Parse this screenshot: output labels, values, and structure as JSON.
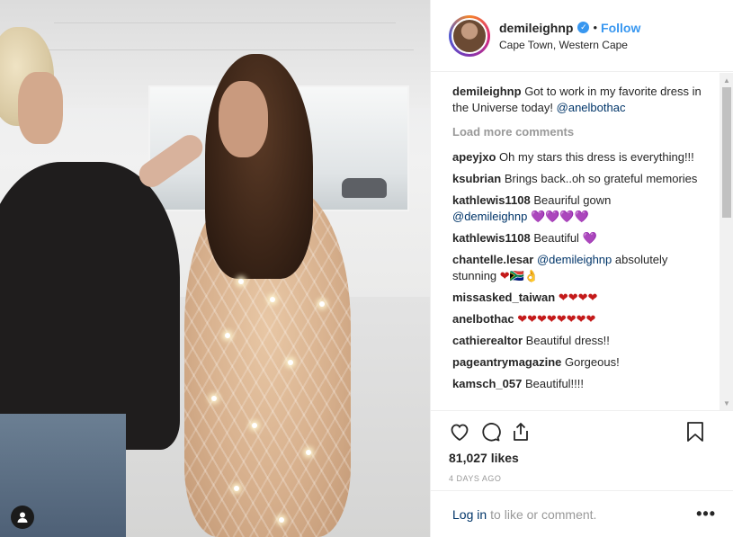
{
  "header": {
    "username": "demileighnp",
    "verified_icon": "verified-badge-icon",
    "separator": "•",
    "follow_label": "Follow",
    "location": "Cape Town, Western Cape"
  },
  "caption": {
    "username": "demileighnp",
    "text": "Got to work in my favorite dress in the Universe today!",
    "mention": "@anelbothac"
  },
  "load_more_label": "Load more comments",
  "comments": [
    {
      "username": "apeyjxo",
      "text": "Oh my stars this dress is everything!!!"
    },
    {
      "username": "ksubrian",
      "text": "Brings back..oh so grateful memories"
    },
    {
      "username": "kathlewis1108",
      "text": "Beauriful gown",
      "mention": "@demileighnp",
      "emoji": "💜💜💜💜"
    },
    {
      "username": "kathlewis1108",
      "text": "Beautiful",
      "emoji": "💜"
    },
    {
      "username": "chantelle.lesar",
      "mention": "@demileighnp",
      "text": "absolutely stunning",
      "emoji": "❤🇿🇦👌"
    },
    {
      "username": "missasked_taiwan",
      "text": "",
      "emoji": "❤❤❤❤"
    },
    {
      "username": "anelbothac",
      "text": "",
      "emoji": "❤❤❤❤❤❤❤❤"
    },
    {
      "username": "cathierealtor",
      "text": "Beautiful dress!!"
    },
    {
      "username": "pageantrymagazine",
      "text": "Gorgeous!"
    },
    {
      "username": "kamsch_057",
      "text": "Beautiful!!!!"
    }
  ],
  "likes": "81,027 likes",
  "time_ago": "4 DAYS AGO",
  "login": {
    "link": "Log in",
    "rest": "to like or comment.",
    "more": "•••"
  },
  "colors": {
    "link_blue": "#3897f0",
    "mention": "#003569",
    "muted": "#999999"
  }
}
